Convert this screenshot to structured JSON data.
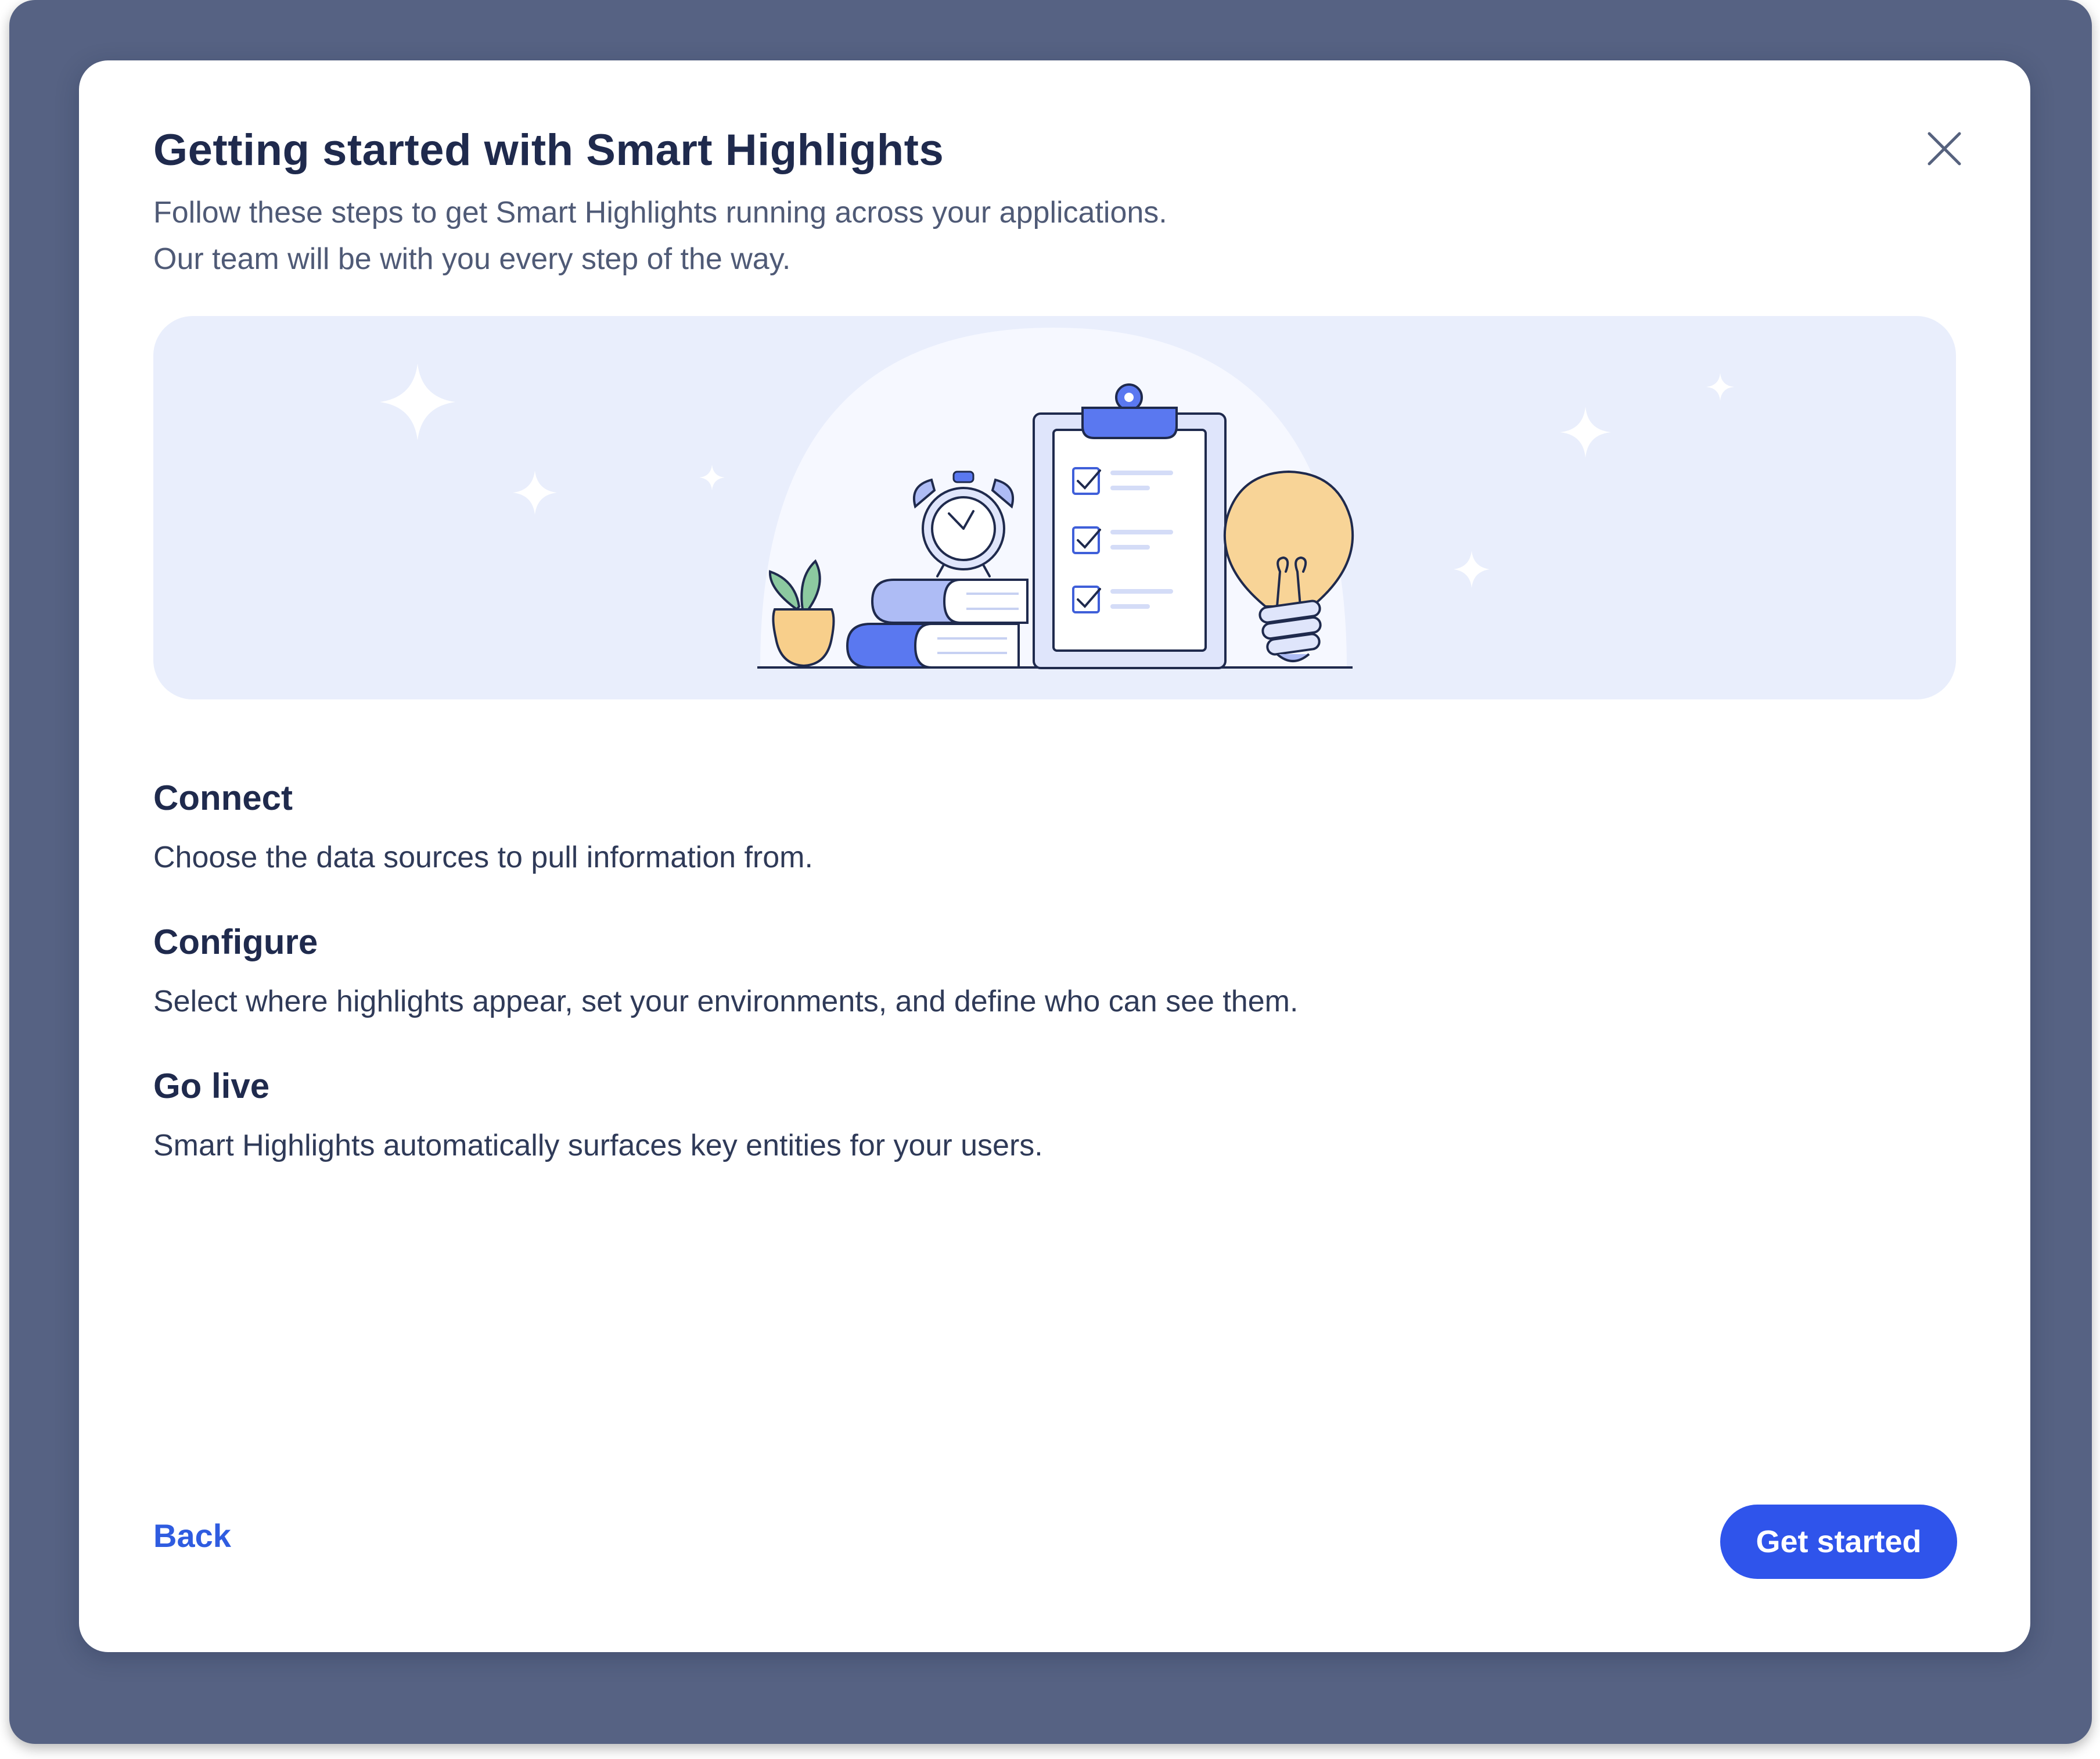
{
  "dialog": {
    "title": "Getting started with Smart Highlights",
    "subtitle_line1": "Follow these steps to get Smart Highlights running across your applications.",
    "subtitle_line2": "Our team will be with you every step of the way.",
    "close_icon": "close-icon"
  },
  "illustration": {
    "icons": [
      "sparkle-icon",
      "plant-icon",
      "books-icon",
      "alarm-clock-icon",
      "clipboard-checklist-icon",
      "lightbulb-icon"
    ]
  },
  "steps": [
    {
      "title": "Connect",
      "description": "Choose the data sources to pull information from."
    },
    {
      "title": "Configure",
      "description": "Select where highlights appear, set your environments, and define who can see them."
    },
    {
      "title": "Go live",
      "description": "Smart Highlights automatically surfaces key entities for your users."
    }
  ],
  "footer": {
    "back_label": "Back",
    "primary_label": "Get started"
  },
  "colors": {
    "backdrop": "#566283",
    "illustration_bg": "#e9eefc",
    "primary": "#2f54eb",
    "link": "#2f5ce0",
    "title": "#1f2a4d"
  }
}
